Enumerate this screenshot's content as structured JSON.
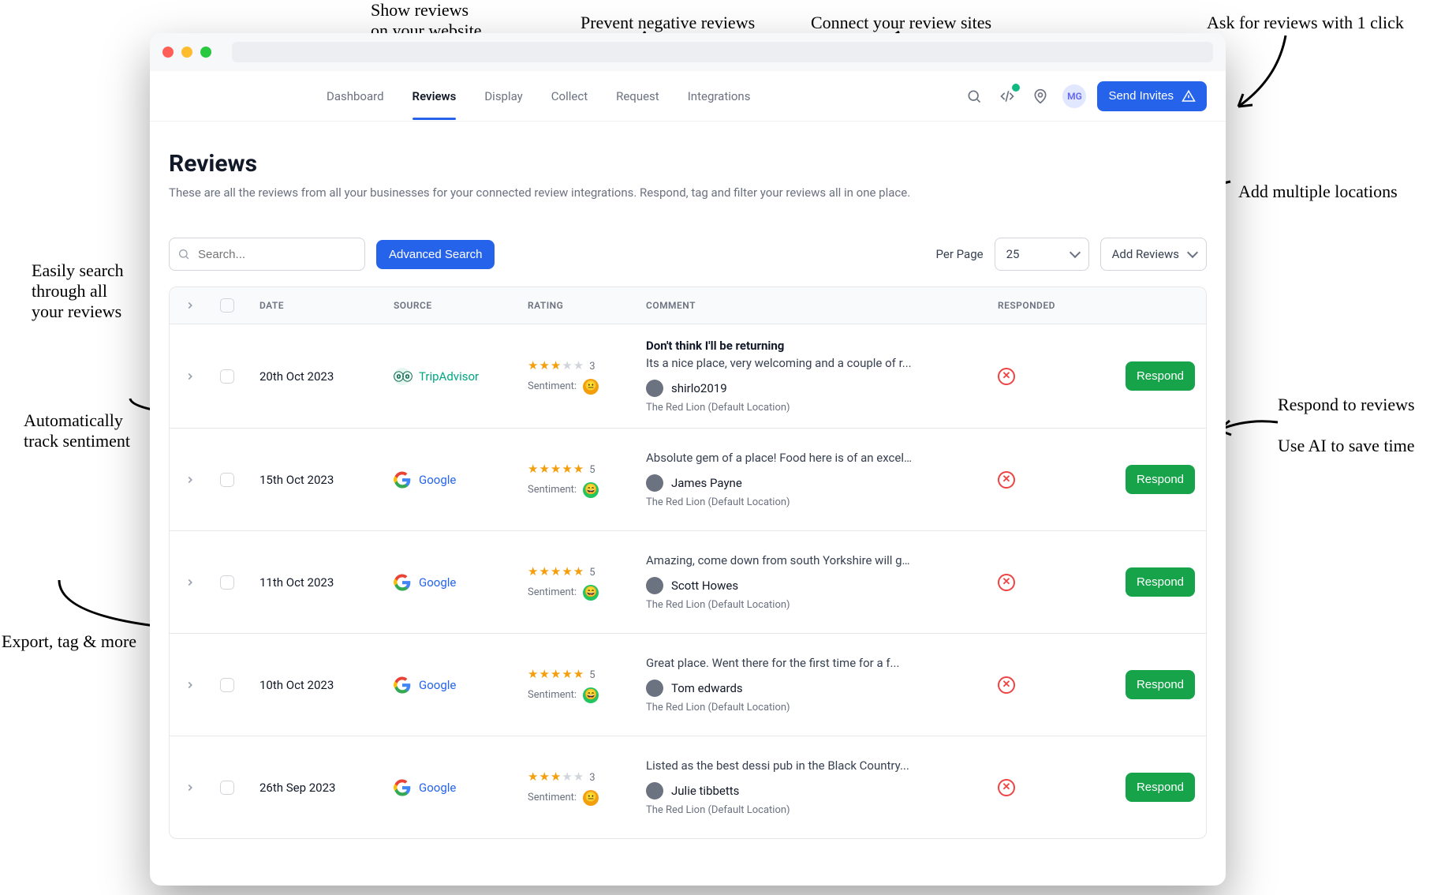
{
  "annotations": {
    "show_reviews": "Show reviews\non your website",
    "prevent_neg": "Prevent negative reviews",
    "connect_sites": "Connect your review sites",
    "ask_reviews": "Ask for reviews with 1 click",
    "multi_loc": "Add multiple locations",
    "respond_ai": "Respond to reviews\n\nUse AI to save time",
    "search_all": "Easily search\nthrough all\nyour reviews",
    "track_sent": "Automatically\ntrack sentiment",
    "export_tag": "Export, tag & more"
  },
  "nav": {
    "tabs": [
      "Dashboard",
      "Reviews",
      "Display",
      "Collect",
      "Request",
      "Integrations"
    ],
    "active": 1,
    "avatar": "MG",
    "send_invites": "Send Invites"
  },
  "page": {
    "title": "Reviews",
    "subtitle": "These are all the reviews from all your businesses for your connected review integrations. Respond, tag and filter your reviews all in one place."
  },
  "toolbar": {
    "search_placeholder": "Search...",
    "advanced": "Advanced Search",
    "per_page_label": "Per Page",
    "per_page_value": "25",
    "add_reviews": "Add Reviews"
  },
  "table": {
    "headers": {
      "date": "DATE",
      "source": "SOURCE",
      "rating": "RATING",
      "comment": "COMMENT",
      "responded": "RESPONDED"
    },
    "sentiment_label": "Sentiment:",
    "respond_label": "Respond",
    "rows": [
      {
        "date": "20th Oct 2023",
        "source": "TripAdvisor",
        "source_type": "tripadvisor",
        "rating": 3,
        "sentiment": "neutral",
        "title": "Don't think I'll be returning",
        "text": "Its a nice place, very welcoming and a couple of r...",
        "author": "shirlo2019",
        "location": "The Red Lion (Default Location)",
        "responded": false
      },
      {
        "date": "15th Oct 2023",
        "source": "Google",
        "source_type": "google",
        "rating": 5,
        "sentiment": "happy",
        "title": "",
        "text": "Absolute gem of a place! Food here is of an excell...",
        "author": "James Payne",
        "location": "The Red Lion (Default Location)",
        "responded": false
      },
      {
        "date": "11th Oct 2023",
        "source": "Google",
        "source_type": "google",
        "rating": 5,
        "sentiment": "happy",
        "title": "",
        "text": "Amazing, come down from south Yorkshire will go t...",
        "author": "Scott Howes",
        "location": "The Red Lion (Default Location)",
        "responded": false
      },
      {
        "date": "10th Oct 2023",
        "source": "Google",
        "source_type": "google",
        "rating": 5,
        "sentiment": "happy",
        "title": "",
        "text": "Great place. Went there for the first time for a f...",
        "author": "Tom edwards",
        "location": "The Red Lion (Default Location)",
        "responded": false
      },
      {
        "date": "26th Sep 2023",
        "source": "Google",
        "source_type": "google",
        "rating": 3,
        "sentiment": "neutral",
        "title": "",
        "text": "Listed as the best dessi pub in the Black Country...",
        "author": "Julie tibbetts",
        "location": "The Red Lion (Default Location)",
        "responded": false
      }
    ]
  }
}
